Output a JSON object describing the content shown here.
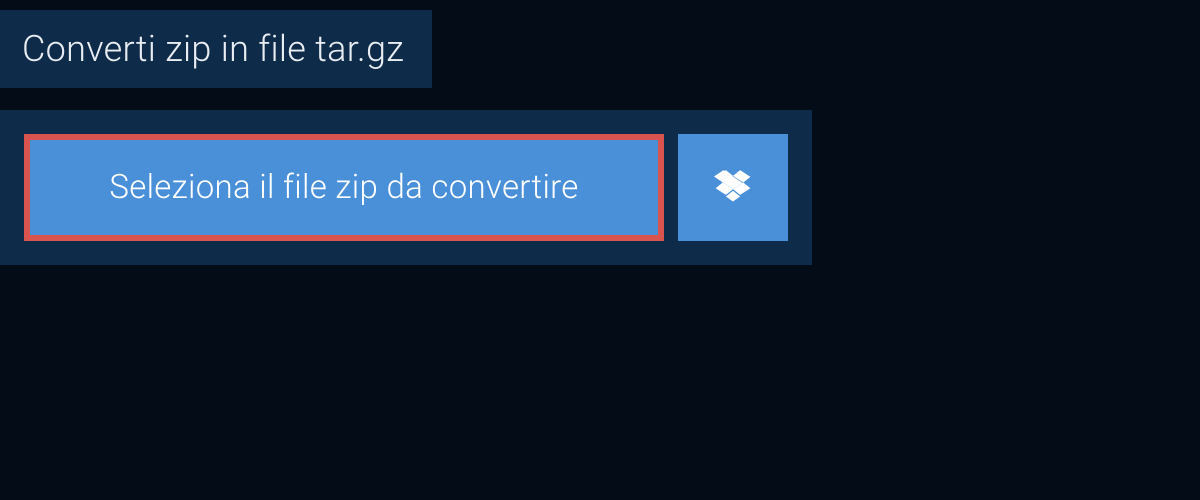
{
  "header": {
    "title": "Converti zip in file tar.gz"
  },
  "buttons": {
    "select_file_label": "Seleziona il file zip da convertire"
  },
  "colors": {
    "background": "#030c17",
    "panel": "#0f2b4a",
    "button_primary": "#4a90d9",
    "highlight_border": "#d9534f",
    "text": "#ffffff"
  }
}
